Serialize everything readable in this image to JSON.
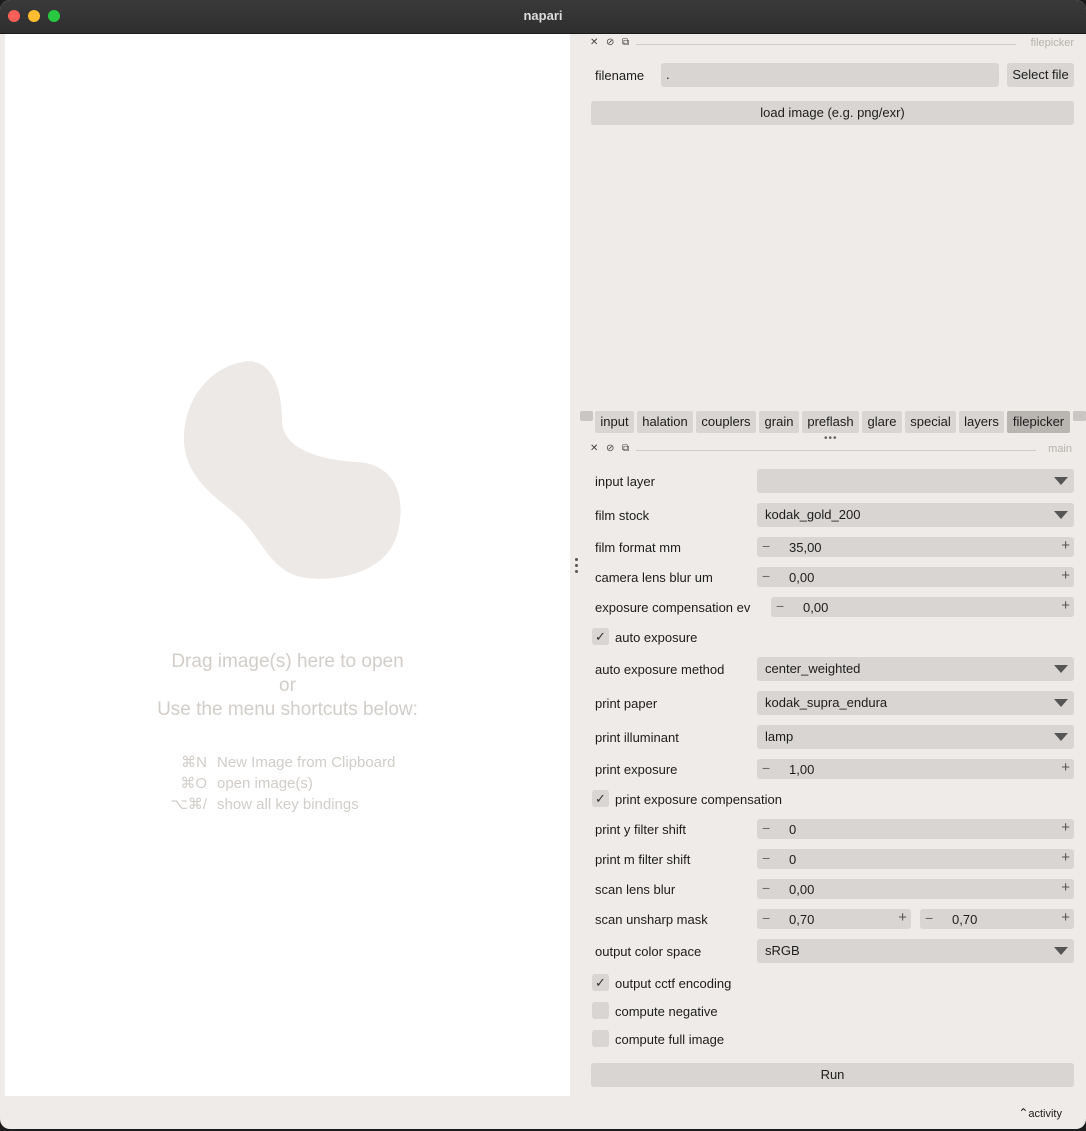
{
  "window": {
    "title": "napari"
  },
  "canvas": {
    "welcome_line1": "Drag image(s) here to open",
    "welcome_line2": "or",
    "welcome_line3": "Use the menu shortcuts below:",
    "shortcuts": [
      {
        "keys": "⌘N",
        "label": "New Image from Clipboard"
      },
      {
        "keys": "⌘O",
        "label": "open image(s)"
      },
      {
        "keys": "⌥⌘/",
        "label": "show all key bindings"
      }
    ]
  },
  "filepicker": {
    "dock_name": "filepicker",
    "filename_label": "filename",
    "filename_value": ".",
    "select_file": "Select file",
    "load_image": "load image (e.g. png/exr)"
  },
  "tabs": [
    {
      "label": "input"
    },
    {
      "label": "halation"
    },
    {
      "label": "couplers"
    },
    {
      "label": "grain"
    },
    {
      "label": "preflash"
    },
    {
      "label": "glare"
    },
    {
      "label": "special"
    },
    {
      "label": "layers"
    },
    {
      "label": "filepicker"
    }
  ],
  "active_tab": "filepicker",
  "main": {
    "dock_name": "main",
    "input_layer": {
      "label": "input layer",
      "value": ""
    },
    "film_stock": {
      "label": "film stock",
      "value": "kodak_gold_200"
    },
    "film_format_mm": {
      "label": "film format mm",
      "value": "35,00"
    },
    "camera_lens_blur_um": {
      "label": "camera lens blur um",
      "value": "0,00"
    },
    "exposure_compensation_ev": {
      "label": "exposure compensation ev",
      "value": "0,00"
    },
    "auto_exposure": {
      "label": "auto exposure",
      "checked": true
    },
    "auto_exposure_method": {
      "label": "auto exposure method",
      "value": "center_weighted"
    },
    "print_paper": {
      "label": "print paper",
      "value": "kodak_supra_endura"
    },
    "print_illuminant": {
      "label": "print illuminant",
      "value": "lamp"
    },
    "print_exposure": {
      "label": "print exposure",
      "value": "1,00"
    },
    "print_exposure_compensation": {
      "label": "print exposure compensation",
      "checked": true
    },
    "print_y_filter_shift": {
      "label": "print y filter shift",
      "value": "0"
    },
    "print_m_filter_shift": {
      "label": "print m filter shift",
      "value": "0"
    },
    "scan_lens_blur": {
      "label": "scan lens blur",
      "value": "0,00"
    },
    "scan_unsharp_mask": {
      "label": "scan unsharp mask",
      "value1": "0,70",
      "value2": "0,70"
    },
    "output_color_space": {
      "label": "output color space",
      "value": "sRGB"
    },
    "output_cctf_encoding": {
      "label": "output cctf encoding",
      "checked": true
    },
    "compute_negative": {
      "label": "compute negative",
      "checked": false
    },
    "compute_full_image": {
      "label": "compute full image",
      "checked": false
    },
    "run": "Run"
  },
  "status": {
    "activity": "activity"
  },
  "icons": {
    "close": "close-icon",
    "hide": "hide-icon",
    "float": "float-icon",
    "chevron": "chevron-up-icon"
  }
}
